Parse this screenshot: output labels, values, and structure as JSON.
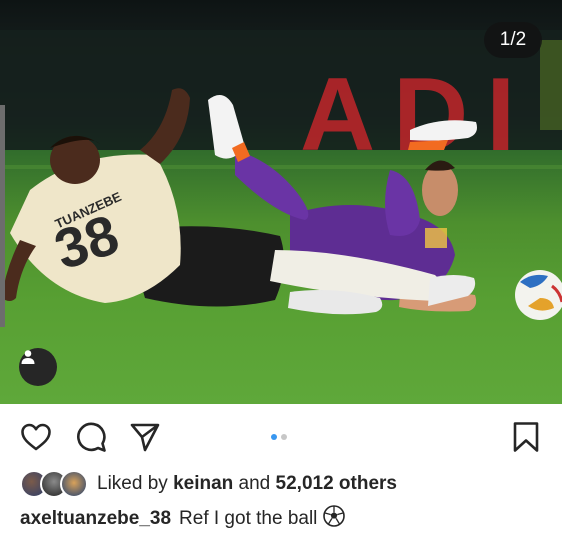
{
  "post": {
    "image_counter": "1/2",
    "photo_alt": "Two footballers sliding on the pitch, player 38 in a cream kit and a goalkeeper in purple",
    "jersey_name": "TUANZEBE",
    "jersey_number": "38",
    "banner_text": "ADI",
    "carousel": {
      "count": 2,
      "active_index": 0
    }
  },
  "actions": {
    "like_icon": "heart-icon",
    "comment_icon": "comment-icon",
    "share_icon": "paper-plane-icon",
    "save_icon": "bookmark-icon"
  },
  "likes": {
    "prefix": "Liked by",
    "user": "keinan",
    "joiner": "and",
    "others": "52,012 others"
  },
  "caption": {
    "username": "axeltuanzebe_38",
    "text": "Ref I got the ball"
  },
  "colors": {
    "accent_blue": "#3897f0",
    "dot_inactive": "#c7c7c7",
    "text": "#262626"
  }
}
